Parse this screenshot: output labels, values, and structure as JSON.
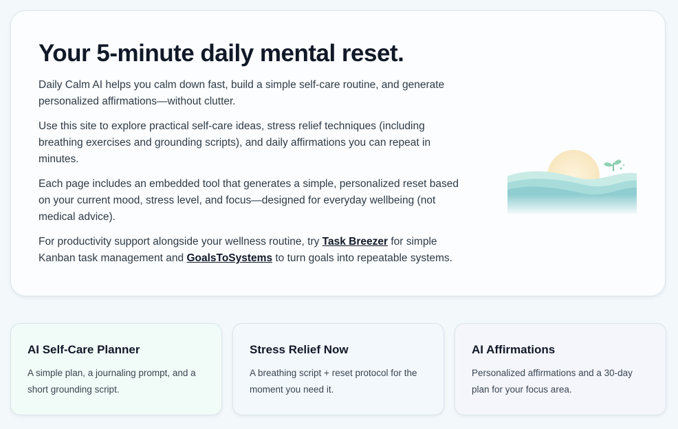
{
  "hero": {
    "title": "Your 5-minute daily mental reset.",
    "p1": "Daily Calm AI helps you calm down fast, build a simple self-care routine, and generate personalized affirmations—without clutter.",
    "p2": "Use this site to explore practical self-care ideas, stress relief techniques (including breathing exercises and grounding scripts), and daily affirmations you can repeat in minutes.",
    "p3": "Each page includes an embedded tool that generates a simple, personalized reset based on your current mood, stress level, and focus—designed for everyday wellbeing (not medical advice).",
    "p4": {
      "pre": "For productivity support alongside your wellness routine, try ",
      "link1": "Task Breezer",
      "mid": " for simple Kanban task management and ",
      "link2": "GoalsToSystems",
      "post": " to turn goals into repeatable systems."
    },
    "illustration_icon": "sun-over-waves-icon"
  },
  "cards": [
    {
      "title": "AI Self-Care Planner",
      "desc": "A simple plan, a journaling prompt, and a short grounding script."
    },
    {
      "title": "Stress Relief Now",
      "desc": "A breathing script + reset protocol for the moment you need it."
    },
    {
      "title": "AI Affirmations",
      "desc": "Personalized affirmations and a 30-day plan for your focus area."
    }
  ],
  "colors": {
    "page_bg": "#f3f8fb",
    "card_green": "#f1fbf7",
    "card_blue": "#f3f8fc",
    "card_lavender": "#f5f6fc",
    "wave_teal": "#8fd3d3"
  }
}
